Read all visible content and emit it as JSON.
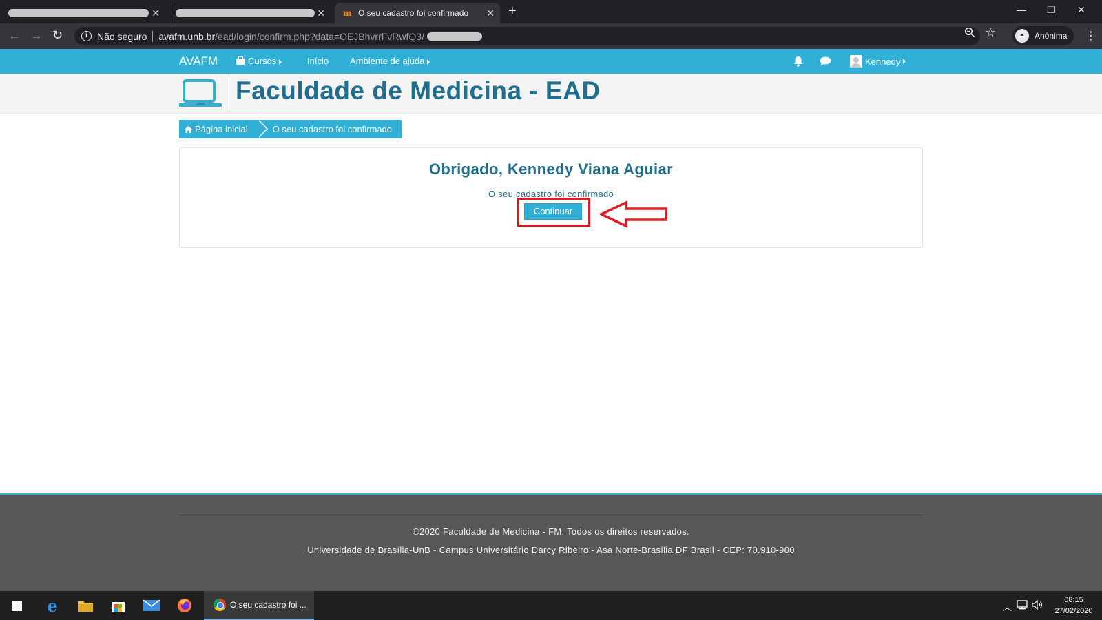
{
  "browser": {
    "tabs": [
      {
        "title": ""
      },
      {
        "title": ""
      },
      {
        "title": "O seu cadastro foi confirmado",
        "favicon": "moodle-icon"
      }
    ],
    "new_tab_glyph": "+",
    "address": {
      "security": "Não seguro",
      "host": "avafm.unb.br",
      "path": "/ead/login/confirm.php?data=OEJBhvrrFvRwfQ3/"
    },
    "profile": "Anônima"
  },
  "site_nav": {
    "brand": "AVAFM",
    "items": [
      {
        "label": "Cursos"
      },
      {
        "label": "Início"
      },
      {
        "label": "Ambiente de ajuda"
      }
    ],
    "user": "Kennedy"
  },
  "header": {
    "title": "Faculdade de Medicina - EAD"
  },
  "breadcrumb": {
    "home": "Página inicial",
    "current": "O seu cadastro foi confirmado"
  },
  "main": {
    "heading": "Obrigado, Kennedy Viana Aguiar",
    "message": "O seu cadastro foi confirmado",
    "continue_label": "Continuar"
  },
  "footer": {
    "copyright": "©2020 Faculdade de Medicina - FM. Todos os direitos reservados.",
    "address": "Universidade de Brasília-UnB - Campus Universitário Darcy Ribeiro -  Asa Norte-Brasília DF  Brasil - CEP: 70.910-900"
  },
  "taskbar": {
    "active_window": "O seu cadastro foi ...",
    "time": "08:15",
    "date": "27/02/2020"
  },
  "colors": {
    "accent": "#30b0d6",
    "title": "#216f8f",
    "highlight": "#e01b24",
    "footer_bg": "#575757"
  }
}
